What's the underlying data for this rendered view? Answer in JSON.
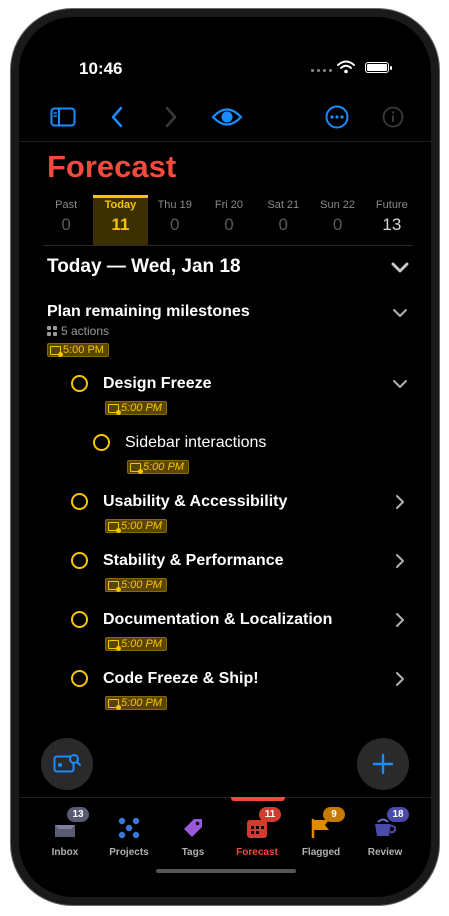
{
  "status": {
    "time": "10:46"
  },
  "header": {
    "title": "Forecast"
  },
  "days": [
    {
      "label": "Past",
      "count": "0"
    },
    {
      "label": "Today",
      "count": "11"
    },
    {
      "label": "Thu 19",
      "count": "0"
    },
    {
      "label": "Fri 20",
      "count": "0"
    },
    {
      "label": "Sat 21",
      "count": "0"
    },
    {
      "label": "Sun 22",
      "count": "0"
    },
    {
      "label": "Future",
      "count": "13"
    }
  ],
  "section": {
    "title": "Today — Wed, Jan 18"
  },
  "project": {
    "title": "Plan remaining milestones",
    "subtitle": "5 actions",
    "due": "5:00 PM"
  },
  "tasks": [
    {
      "title": "Design Freeze",
      "due": "5:00 PM"
    },
    {
      "title": "Sidebar interactions",
      "due": "5:00 PM"
    },
    {
      "title": "Usability & Accessibility",
      "due": "5:00 PM"
    },
    {
      "title": "Stability & Performance",
      "due": "5:00 PM"
    },
    {
      "title": "Documentation & Localization",
      "due": "5:00 PM"
    },
    {
      "title": "Code Freeze & Ship!",
      "due": "5:00 PM"
    }
  ],
  "tabs": [
    {
      "label": "Inbox",
      "badge": "13",
      "badge_color": "#5a5a72"
    },
    {
      "label": "Projects",
      "badge": "",
      "badge_color": ""
    },
    {
      "label": "Tags",
      "badge": "",
      "badge_color": ""
    },
    {
      "label": "Forecast",
      "badge": "11",
      "badge_color": "#d23b30"
    },
    {
      "label": "Flagged",
      "badge": "9",
      "badge_color": "#c57a00"
    },
    {
      "label": "Review",
      "badge": "18",
      "badge_color": "#4a4aa8"
    }
  ],
  "colors": {
    "accent": "#1a8cff",
    "forecast": "#f24a3c",
    "due": "#f6c500"
  }
}
